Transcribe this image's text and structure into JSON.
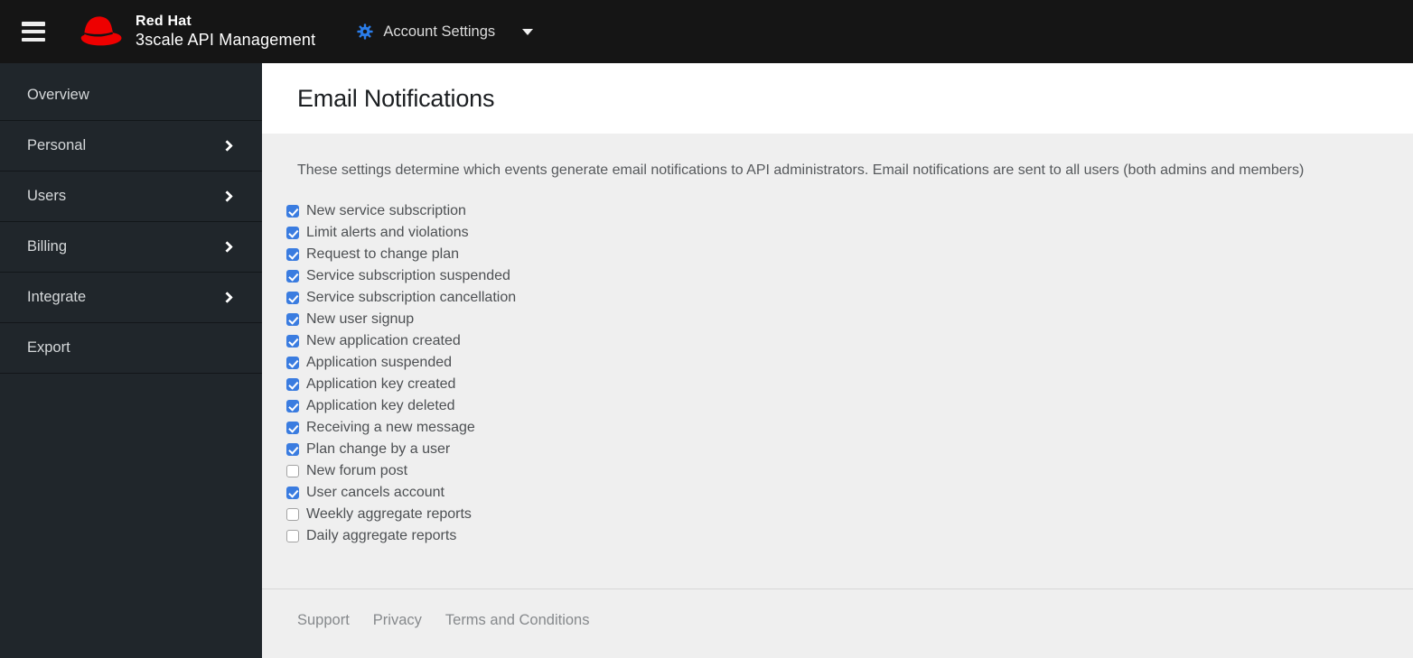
{
  "topbar": {
    "brand_line1": "Red Hat",
    "brand_line2": "3scale API Management",
    "context_label": "Account Settings"
  },
  "sidebar": {
    "items": [
      {
        "label": "Overview",
        "expandable": false
      },
      {
        "label": "Personal",
        "expandable": true
      },
      {
        "label": "Users",
        "expandable": true
      },
      {
        "label": "Billing",
        "expandable": true
      },
      {
        "label": "Integrate",
        "expandable": true
      },
      {
        "label": "Export",
        "expandable": false
      }
    ]
  },
  "main": {
    "title": "Email Notifications",
    "description": "These settings determine which events generate email notifications to API administrators. Email notifications are sent to all users (both admins and members)",
    "notifications": [
      {
        "label": "New service subscription",
        "checked": true
      },
      {
        "label": "Limit alerts and violations",
        "checked": true
      },
      {
        "label": "Request to change plan",
        "checked": true
      },
      {
        "label": "Service subscription suspended",
        "checked": true
      },
      {
        "label": "Service subscription cancellation",
        "checked": true
      },
      {
        "label": "New user signup",
        "checked": true
      },
      {
        "label": "New application created",
        "checked": true
      },
      {
        "label": "Application suspended",
        "checked": true
      },
      {
        "label": "Application key created",
        "checked": true
      },
      {
        "label": "Application key deleted",
        "checked": true
      },
      {
        "label": "Receiving a new message",
        "checked": true
      },
      {
        "label": "Plan change by a user",
        "checked": true
      },
      {
        "label": "New forum post",
        "checked": false
      },
      {
        "label": "User cancels account",
        "checked": true
      },
      {
        "label": "Weekly aggregate reports",
        "checked": false
      },
      {
        "label": "Daily aggregate reports",
        "checked": false
      }
    ]
  },
  "footer": {
    "links": [
      "Support",
      "Privacy",
      "Terms and Conditions"
    ]
  },
  "icons": {
    "hamburger": "menu-icon",
    "fedora": "red-hat-logo",
    "gear": "gear-icon",
    "caret": "chevron-down-icon",
    "nav_chevron": "chevron-right-icon"
  },
  "colors": {
    "topbar_bg": "#151515",
    "sidebar_bg": "#20262b",
    "panel_bg": "#efefef",
    "checkbox_checked_blue": "#3a7ce0",
    "brand_red": "#ee0000",
    "gear_blue": "#2b7de9"
  }
}
